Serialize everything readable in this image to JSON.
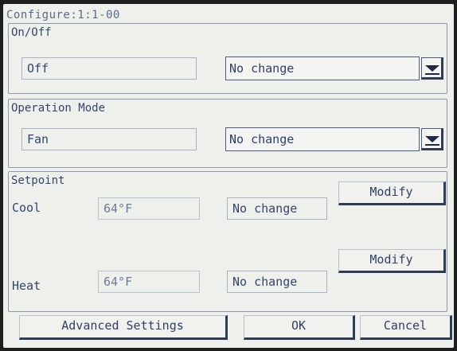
{
  "title": "Configure:1:1-00",
  "onoff": {
    "label": "On/Off",
    "current": "Off",
    "select_value": "No change",
    "dropdown_icon": "chevron-down-icon"
  },
  "operation_mode": {
    "label": "Operation Mode",
    "current": "Fan",
    "select_value": "No change",
    "dropdown_icon": "chevron-down-icon"
  },
  "setpoint": {
    "label": "Setpoint",
    "cool_label": "Cool",
    "cool_value": "64°F",
    "cool_change": "No change",
    "cool_modify": "Modify",
    "heat_label": "Heat",
    "heat_value": "64°F",
    "heat_change": "No change",
    "heat_modify": "Modify"
  },
  "footer": {
    "advanced": "Advanced Settings",
    "ok": "OK",
    "cancel": "Cancel"
  }
}
